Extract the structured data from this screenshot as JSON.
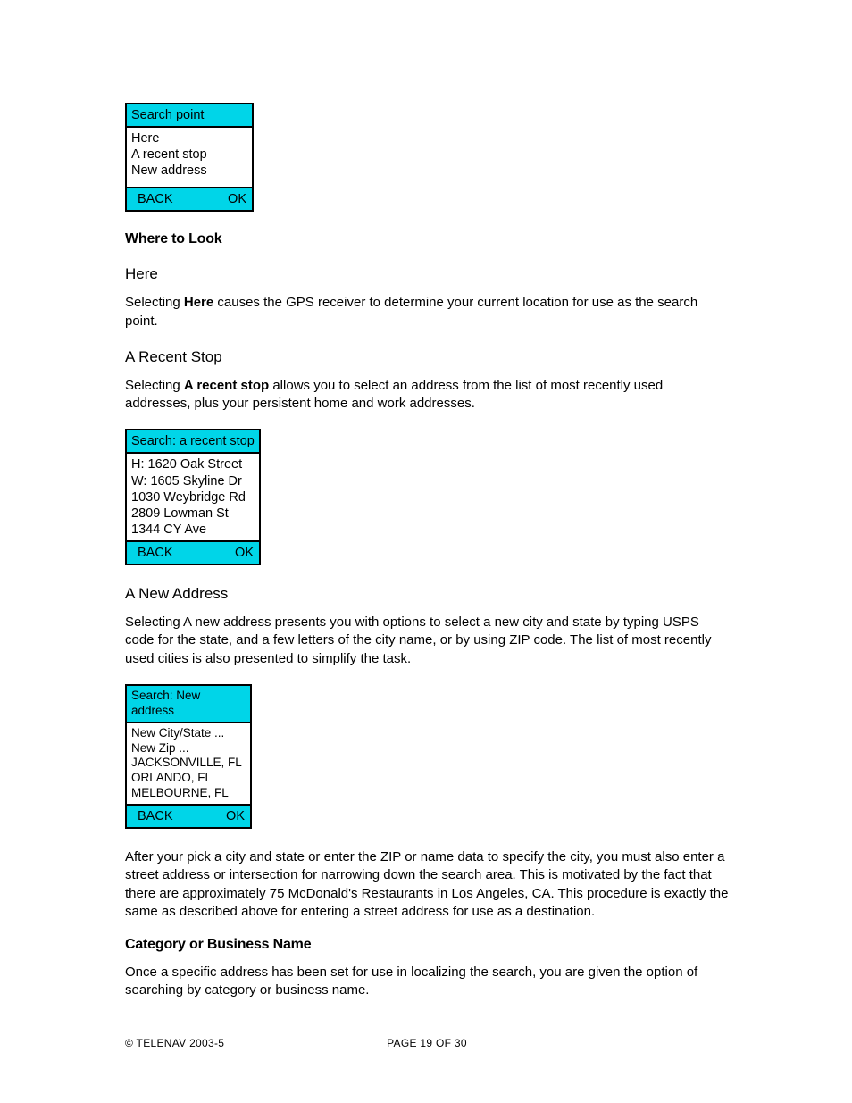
{
  "screens": {
    "searchPoint": {
      "title": "Search point",
      "items": [
        "Here",
        "A recent stop",
        "New address"
      ],
      "back": "BACK",
      "ok": "OK"
    },
    "recentStop": {
      "title": "Search: a recent stop",
      "items": [
        "H: 1620 Oak Street",
        "W: 1605 Skyline Dr",
        "1030 Weybridge Rd",
        "2809 Lowman St",
        "1344 CY Ave"
      ],
      "back": "BACK",
      "ok": "OK"
    },
    "newAddress": {
      "title": "Search: New address",
      "items": [
        "New City/State ...",
        "New Zip ...",
        "JACKSONVILLE, FL",
        "ORLANDO, FL",
        "MELBOURNE, FL"
      ],
      "back": "BACK",
      "ok": "OK"
    }
  },
  "headings": {
    "whereToLook": "Where to Look",
    "here": "Here",
    "aRecentStop": "A Recent Stop",
    "aNewAddress": "A New Address",
    "categoryOrBusiness": "Category or Business Name"
  },
  "paragraphs": {
    "herePre": "Selecting ",
    "hereBold": "Here",
    "herePost": " causes the GPS receiver to determine your current location for use as the search point.",
    "recentPre": "Selecting ",
    "recentBold": "A recent stop",
    "recentPost": " allows you to select an address from the list of most recently used addresses, plus your persistent home and work addresses.",
    "newAddress": "Selecting A new address presents you with options to select a new city and state by typing USPS code for the state, and a few letters of the city name, or by using ZIP code.  The list of most recently used cities is also presented to simplify the task.",
    "afterPick": "After your pick a city and state or enter the ZIP or name data to specify the city, you must also enter a street address or intersection for narrowing down the search area.  This is motivated by the fact that there are approximately 75 McDonald's Restaurants in Los Angeles, CA.  This procedure is exactly the same as described above for entering a street address for use as a destination.",
    "category": "Once a specific address has been set for use in localizing the search, you are given the option of searching by category or business name."
  },
  "footer": {
    "copyright": "© TELENAV 2003-5",
    "page": "PAGE 19 OF 30"
  }
}
